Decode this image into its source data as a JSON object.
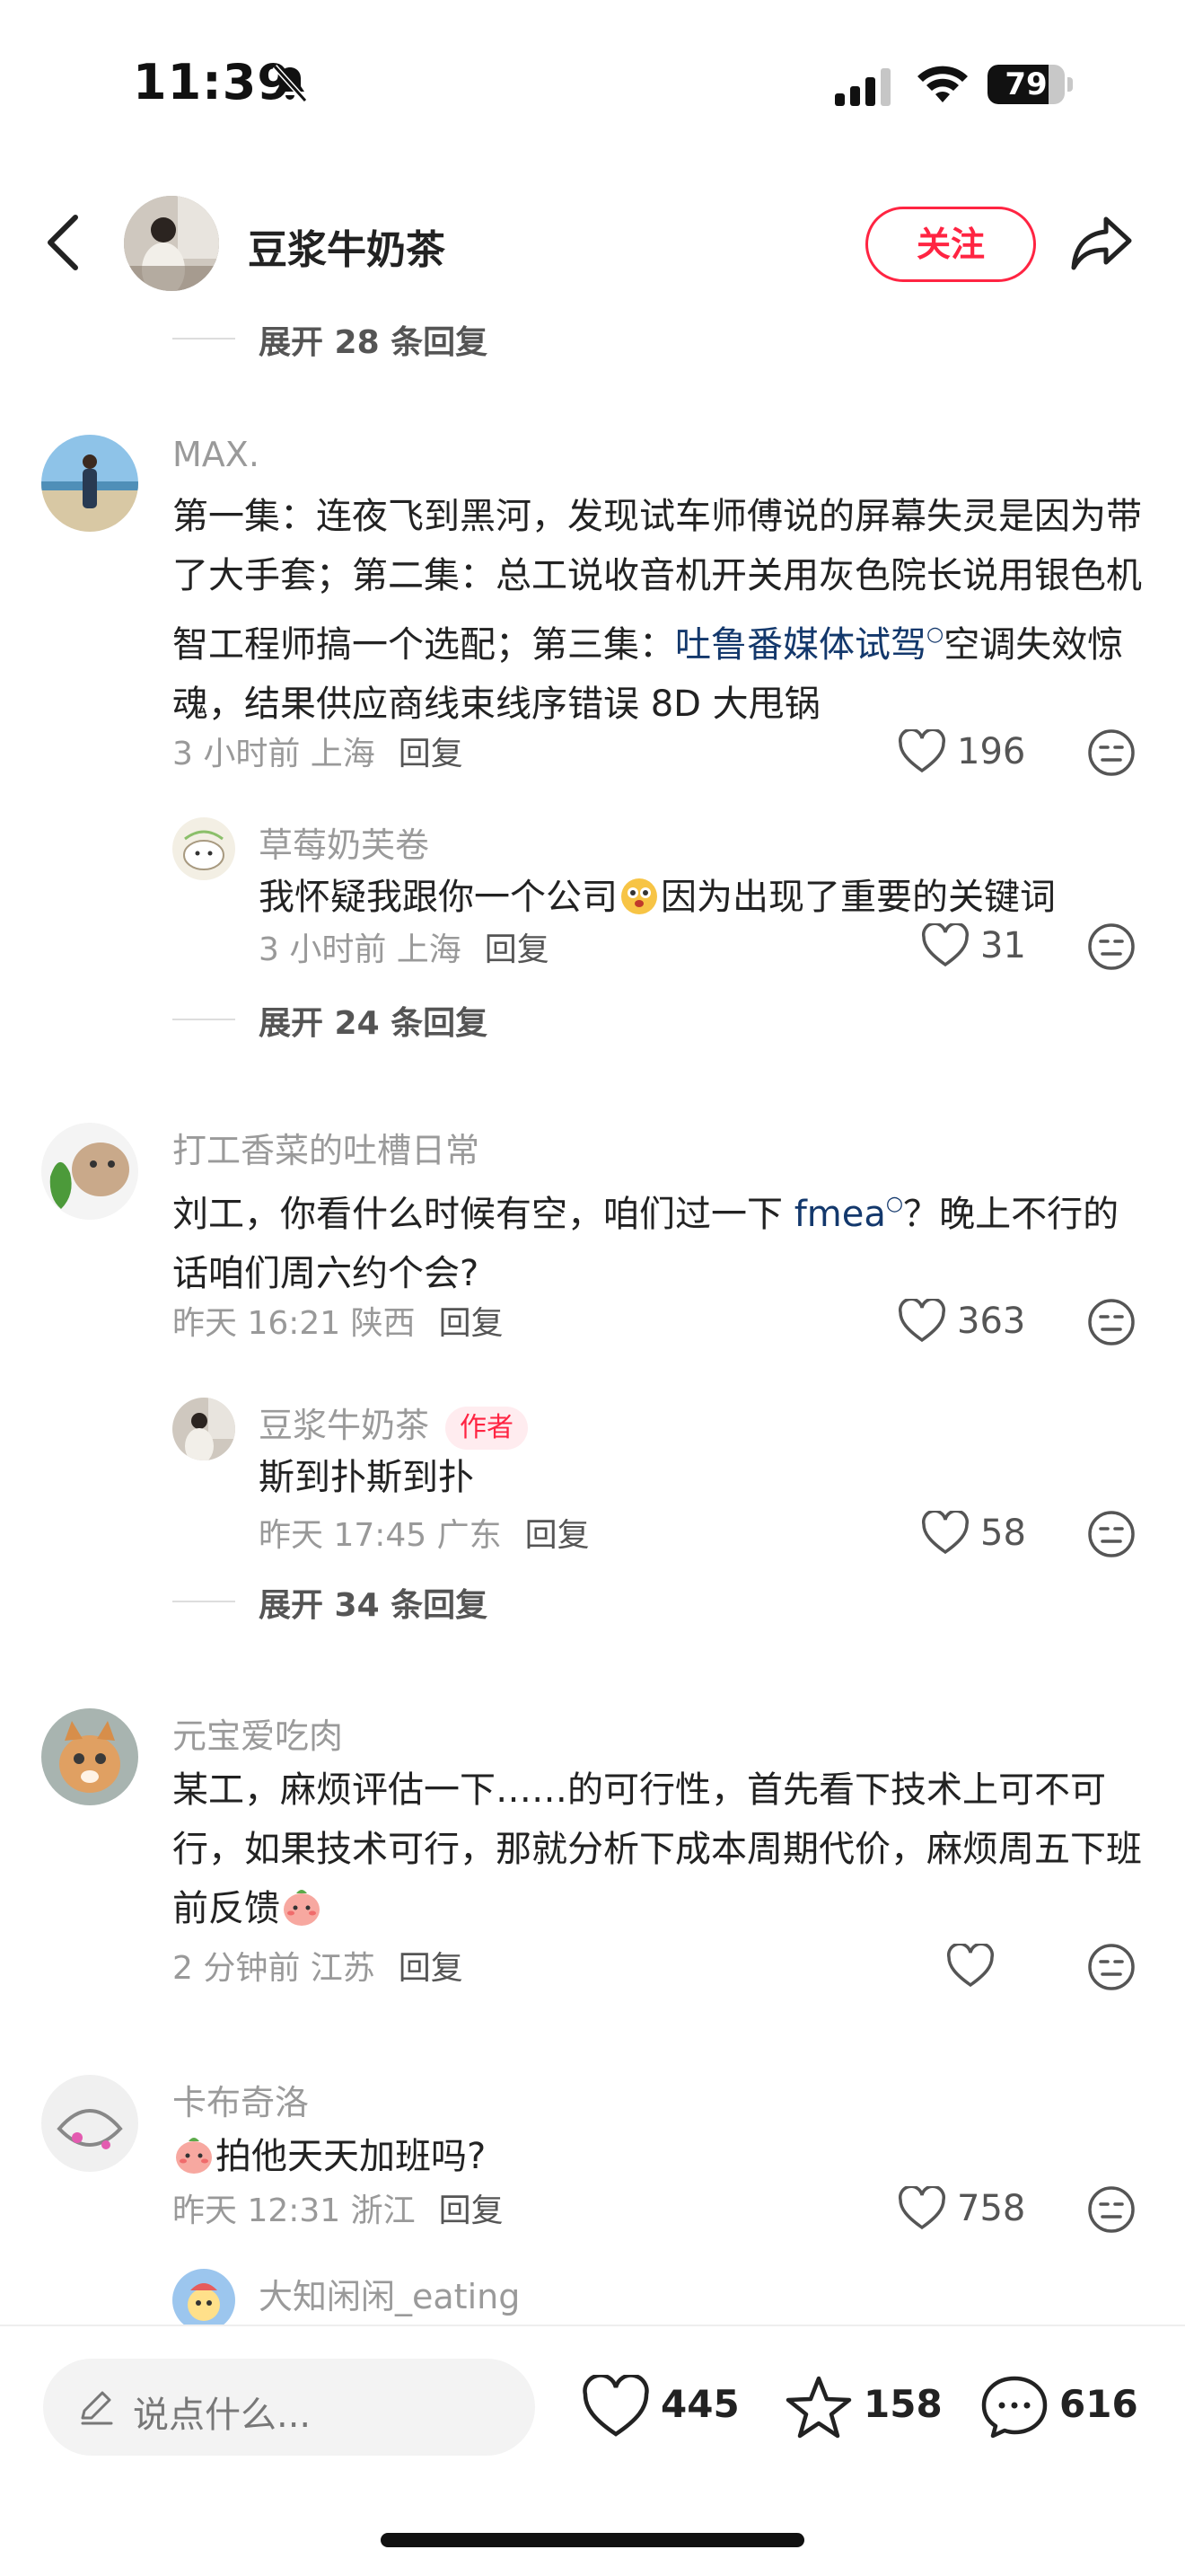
{
  "status_bar": {
    "time": "11:39",
    "battery": "79",
    "battery_level": 0.79
  },
  "header": {
    "author_name": "豆浆牛奶茶",
    "follow_label": "关注"
  },
  "comments": [
    {
      "expand": "展开 28 条回复"
    },
    {
      "name": "MAX.",
      "text_before": "第一集：连夜飞到黑河，发现试车师傅说的屏幕失灵是因为带了大手套；第二集：总工说收音机开关用灰色院长说用银色机智工程师搞一个选配；第三集：",
      "link": "吐鲁番媒体试驾",
      "text_after": "空调失效惊魂，结果供应商线束线序错误 8D 大甩锅",
      "time": "3 小时前 上海",
      "reply": "回复",
      "likes": "196"
    },
    {
      "name": "草莓奶芙卷",
      "text_before": "我怀疑我跟你一个公司",
      "text_after": "因为出现了重要的关键词",
      "time": "3 小时前 上海",
      "reply": "回复",
      "likes": "31"
    },
    {
      "expand": "展开 24 条回复"
    },
    {
      "name": "打工香菜的吐槽日常",
      "text_before": "刘工，你看什么时候有空，咱们过一下 ",
      "link": "fmea",
      "text_after": "？晚上不行的话咱们周六约个会?",
      "time": "昨天 16:21 陕西",
      "reply": "回复",
      "likes": "363"
    },
    {
      "name": "豆浆牛奶茶",
      "badge": "作者",
      "text": "斯到扑斯到扑",
      "time": "昨天 17:45 广东",
      "reply": "回复",
      "likes": "58"
    },
    {
      "expand": "展开 34 条回复"
    },
    {
      "name": "元宝爱吃肉",
      "text": "某工，麻烦评估一下……的可行性，首先看下技术上可不可行，如果技术可行，那就分析下成本周期代价，麻烦周五下班前反馈",
      "time": "2 分钟前 江苏",
      "reply": "回复",
      "likes": ""
    },
    {
      "name": "卡布奇洛",
      "text": "拍他天天加班吗?",
      "time": "昨天 12:31 浙江",
      "reply": "回复",
      "likes": "758"
    },
    {
      "name": "大知闲闲_eating"
    }
  ],
  "bottom_bar": {
    "placeholder": "说点什么...",
    "like_count": "445",
    "collect_count": "158",
    "comment_count": "616"
  }
}
